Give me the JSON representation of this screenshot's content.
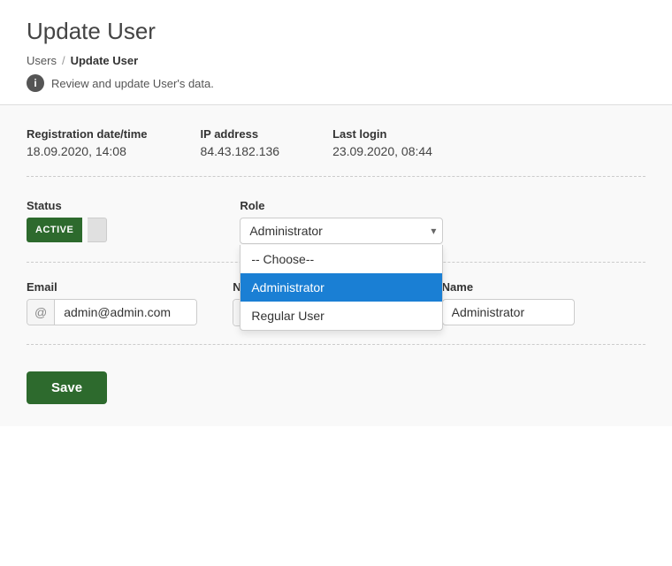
{
  "page": {
    "title": "Update User",
    "breadcrumb": {
      "parent_label": "Users",
      "separator": "/",
      "current_label": "Update User"
    },
    "info_text": "Review and update User's data."
  },
  "meta": {
    "registration_label": "Registration date/time",
    "registration_value": "18.09.2020, 14:08",
    "ip_label": "IP address",
    "ip_value": "84.43.182.136",
    "last_login_label": "Last login",
    "last_login_value": "23.09.2020, 08:44"
  },
  "form": {
    "status_label": "Status",
    "status_value": "ACTIVE",
    "role_label": "Role",
    "role_selected": "Administrator",
    "role_options": [
      {
        "value": "",
        "label": "-- Choose--"
      },
      {
        "value": "admin",
        "label": "Administrator"
      },
      {
        "value": "regular",
        "label": "Regular User"
      }
    ],
    "email_label": "Email",
    "email_value": "admin@admin.com",
    "email_placeholder": "Email",
    "email_icon": "@",
    "password_label": "New password",
    "password_icon": "🔒",
    "name_label": "Name",
    "name_value": "Administrator",
    "save_label": "Save"
  },
  "icons": {
    "info": "i",
    "chevron_down": "▾",
    "at": "@",
    "lock": "🔒"
  }
}
